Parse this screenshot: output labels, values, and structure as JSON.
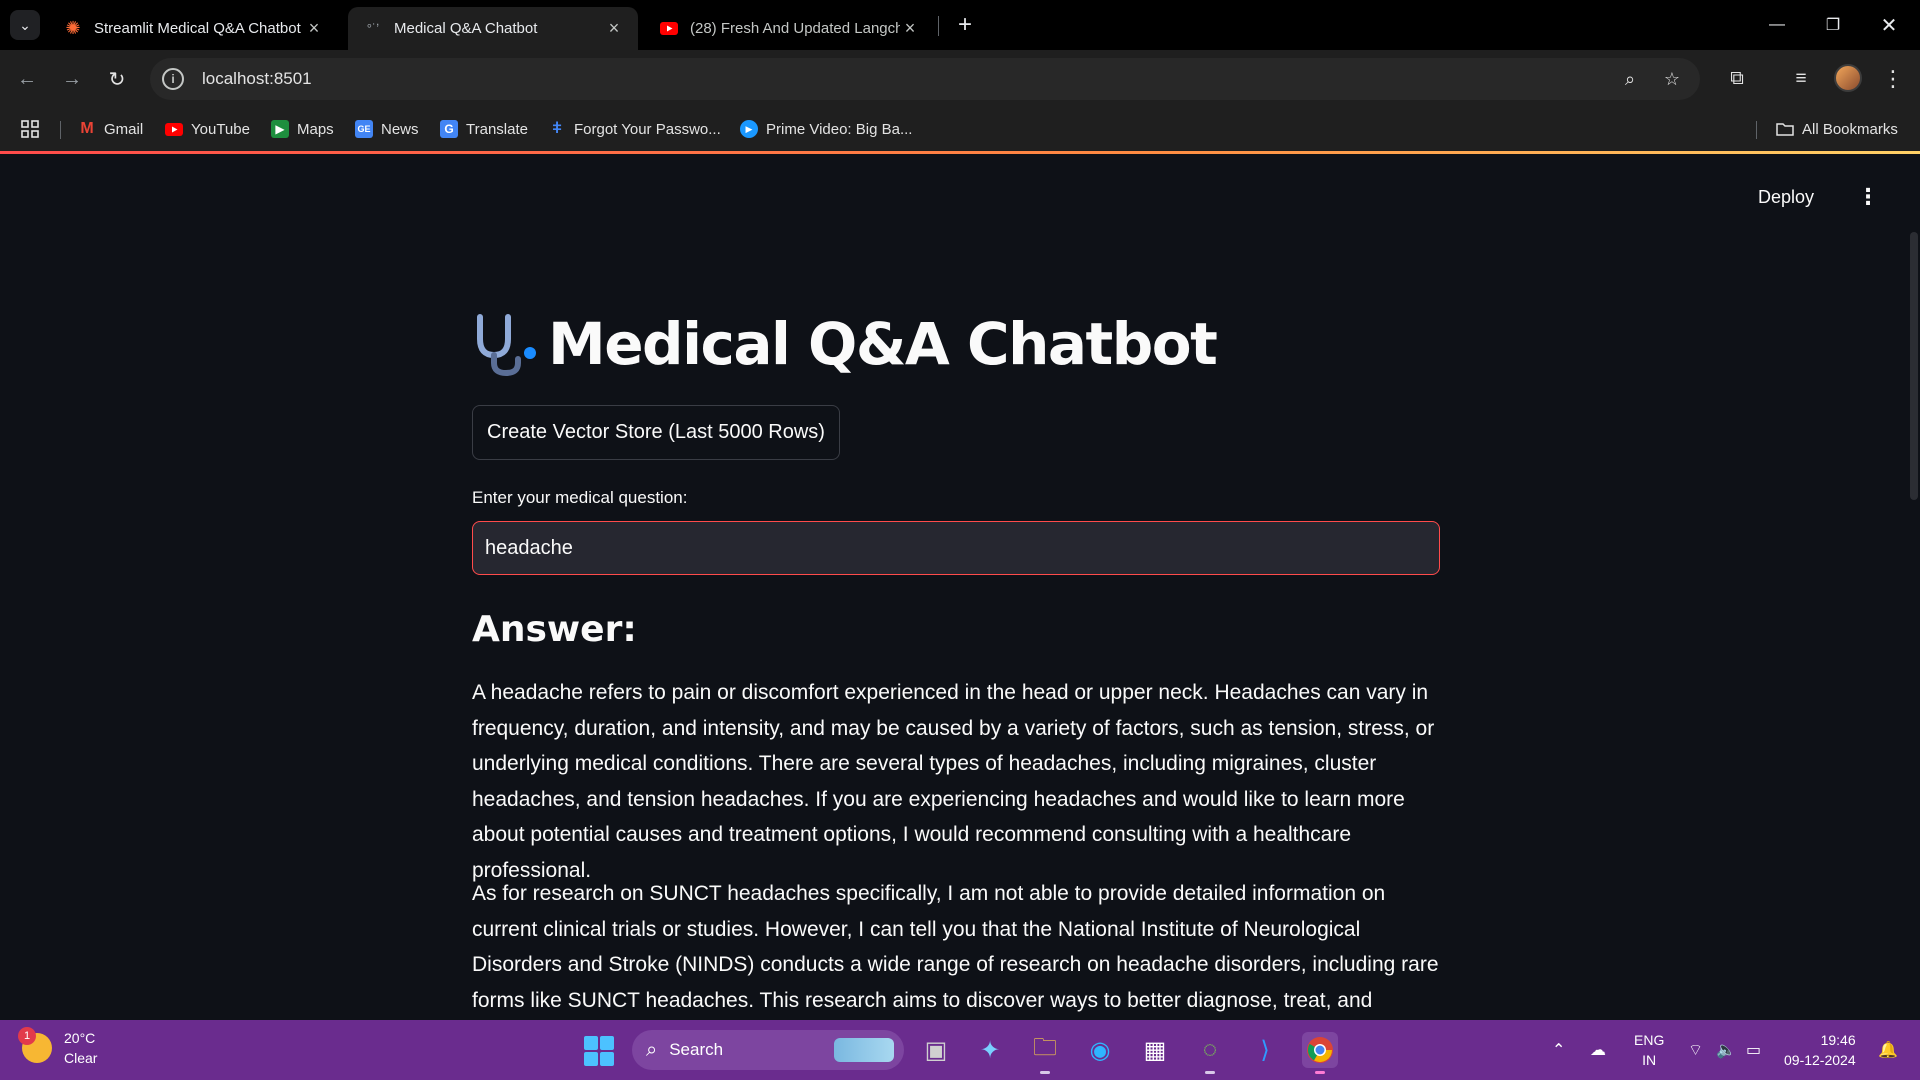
{
  "browser": {
    "tabs": [
      {
        "title": "Streamlit Medical Q&A Chatbot",
        "favicon": "streamlit-star-icon",
        "active": false
      },
      {
        "title": "Medical Q&A Chatbot",
        "favicon": "loading-dots-icon",
        "active": true
      },
      {
        "title": "(28) Fresh And Updated Langchain",
        "favicon": "youtube-icon",
        "active": false
      }
    ],
    "url": "localhost:8501",
    "bookmarks": [
      {
        "label": "Gmail",
        "icon": "gmail-icon",
        "color": "#ea4335"
      },
      {
        "label": "YouTube",
        "icon": "youtube-icon",
        "color": "#ff0000"
      },
      {
        "label": "Maps",
        "icon": "maps-icon",
        "color": "#34a853"
      },
      {
        "label": "News",
        "icon": "news-icon",
        "color": "#4285f4"
      },
      {
        "label": "Translate",
        "icon": "translate-icon",
        "color": "#4285f4"
      },
      {
        "label": "Forgot Your Passwo...",
        "icon": "key-icon",
        "color": "#4285f4"
      },
      {
        "label": "Prime Video: Big Ba...",
        "icon": "prime-video-icon",
        "color": "#1a98ff"
      }
    ],
    "all_bookmarks": "All Bookmarks"
  },
  "app": {
    "deploy_label": "Deploy",
    "title": "Medical Q&A Chatbot",
    "vector_store_button": "Create Vector Store (Last 5000 Rows)",
    "question_label": "Enter your medical question:",
    "question_value": "headache",
    "answer_heading": "Answer:",
    "answer_paragraph_1": "A headache refers to pain or discomfort experienced in the head or upper neck. Headaches can vary in frequency, duration, and intensity, and may be caused by a variety of factors, such as tension, stress, or underlying medical conditions. There are several types of headaches, including migraines, cluster headaches, and tension headaches. If you are experiencing headaches and would like to learn more about potential causes and treatment options, I would recommend consulting with a healthcare professional.",
    "answer_paragraph_2": "As for research on SUNCT headaches specifically, I am not able to provide detailed information on current clinical trials or studies. However, I can tell you that the National Institute of Neurological Disorders and Stroke (NINDS) conducts a wide range of research on headache disorders, including rare forms like SUNCT headaches. This research aims to discover ways to better diagnose, treat, and ultimately, prevent these",
    "accent_color": "#ff4b4b"
  },
  "taskbar": {
    "weather_temp": "20°C",
    "weather_cond": "Clear",
    "weather_badge": "1",
    "search_label": "Search",
    "lang_1": "ENG",
    "lang_2": "IN",
    "time": "19:46",
    "date": "09-12-2024",
    "color": "#6a2c8e"
  }
}
